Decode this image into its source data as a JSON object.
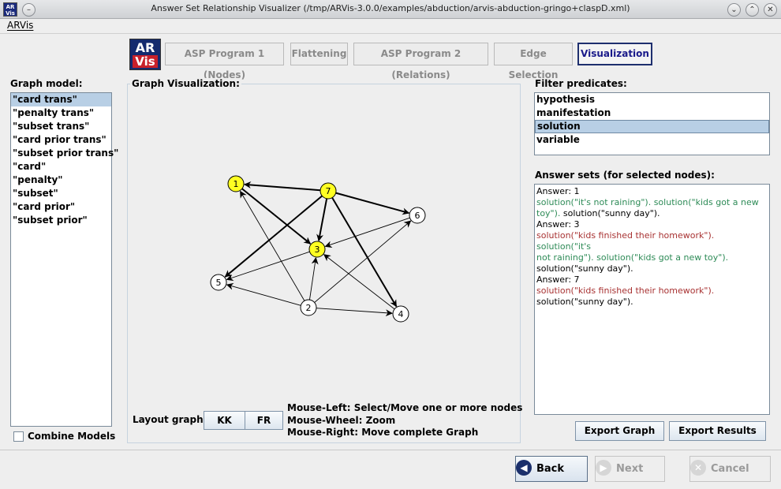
{
  "window": {
    "title": "Answer Set Relationship Visualizer (/tmp/ARVis-3.0.0/examples/abduction/arvis-abduction-gringo+claspD.xml)",
    "icon_top": "AR",
    "icon_bottom": "Vis"
  },
  "menu": {
    "items": [
      "ARVis"
    ]
  },
  "logo": {
    "line1": "AR",
    "line2": "Vis"
  },
  "steps": [
    {
      "label": "ASP Program 1 (Nodes)",
      "active": false
    },
    {
      "label": "Flattening",
      "active": false
    },
    {
      "label": "ASP Program 2 (Relations)",
      "active": false
    },
    {
      "label": "Edge Selection",
      "active": false
    },
    {
      "label": "Visualization",
      "active": true
    }
  ],
  "graph_model": {
    "label": "Graph model:",
    "items": [
      "\"card trans\"",
      "\"penalty trans\"",
      "\"subset trans\"",
      "\"card prior trans\"",
      "\"subset prior trans\"",
      "\"card\"",
      "\"penalty\"",
      "\"subset\"",
      "\"card prior\"",
      "\"subset prior\""
    ],
    "selected_index": 0,
    "combine_label": "Combine Models",
    "combine_checked": false
  },
  "graph": {
    "label": "Graph Visualization:",
    "nodes": [
      {
        "id": "1",
        "highlighted": true
      },
      {
        "id": "7",
        "highlighted": true
      },
      {
        "id": "6",
        "highlighted": false
      },
      {
        "id": "3",
        "highlighted": true
      },
      {
        "id": "5",
        "highlighted": false
      },
      {
        "id": "2",
        "highlighted": false
      },
      {
        "id": "4",
        "highlighted": false
      }
    ],
    "edges": [
      {
        "from": "7",
        "to": "1",
        "bold": true
      },
      {
        "from": "7",
        "to": "6",
        "bold": true
      },
      {
        "from": "7",
        "to": "3",
        "bold": true
      },
      {
        "from": "7",
        "to": "5",
        "bold": true
      },
      {
        "from": "7",
        "to": "4",
        "bold": true
      },
      {
        "from": "1",
        "to": "3",
        "bold": true
      },
      {
        "from": "2",
        "to": "1",
        "bold": false
      },
      {
        "from": "2",
        "to": "3",
        "bold": false
      },
      {
        "from": "2",
        "to": "5",
        "bold": false
      },
      {
        "from": "2",
        "to": "4",
        "bold": false
      },
      {
        "from": "2",
        "to": "6",
        "bold": false
      },
      {
        "from": "6",
        "to": "3",
        "bold": false
      },
      {
        "from": "4",
        "to": "3",
        "bold": false
      },
      {
        "from": "3",
        "to": "5",
        "bold": false
      }
    ],
    "layout_label": "Layout graph:",
    "layout_buttons": [
      "KK",
      "FR"
    ],
    "help": [
      "Mouse-Left: Select/Move one or more nodes",
      "Mouse-Wheel: Zoom",
      "Mouse-Right: Move complete Graph"
    ]
  },
  "filter": {
    "label": "Filter predicates:",
    "items": [
      "hypothesis",
      "manifestation",
      "solution",
      "variable"
    ],
    "selected_index": 2
  },
  "answer_sets": {
    "label": "Answer sets (for selected nodes):",
    "lines": [
      [
        {
          "t": "Answer: 1",
          "c": "black"
        }
      ],
      [
        {
          "t": "solution(\"it's not raining\").",
          "c": "green"
        },
        {
          "t": " solution(\"kids got a new",
          "c": "green"
        }
      ],
      [
        {
          "t": "toy\").",
          "c": "green"
        },
        {
          "t": " solution(\"sunny day\").",
          "c": "black"
        }
      ],
      [
        {
          "t": "Answer: 3",
          "c": "black"
        }
      ],
      [
        {
          "t": "solution(\"kids finished their homework\").",
          "c": "red"
        },
        {
          "t": " solution(\"it's",
          "c": "green"
        }
      ],
      [
        {
          "t": "not raining\").",
          "c": "green"
        },
        {
          "t": " solution(\"kids got a new toy\").",
          "c": "green"
        }
      ],
      [
        {
          "t": "solution(\"sunny day\").",
          "c": "black"
        }
      ],
      [
        {
          "t": "Answer: 7",
          "c": "black"
        }
      ],
      [
        {
          "t": "solution(\"kids finished their homework\").",
          "c": "red"
        }
      ],
      [
        {
          "t": "solution(\"sunny day\").",
          "c": "black"
        }
      ]
    ],
    "export_graph": "Export Graph",
    "export_results": "Export Results"
  },
  "nav": {
    "back": "Back",
    "next": "Next",
    "cancel": "Cancel"
  },
  "colors": {
    "node_highlight": "#ffff22",
    "selection": "#b8cfe5",
    "answer_green": "#2e8b57",
    "answer_red": "#a83232"
  }
}
